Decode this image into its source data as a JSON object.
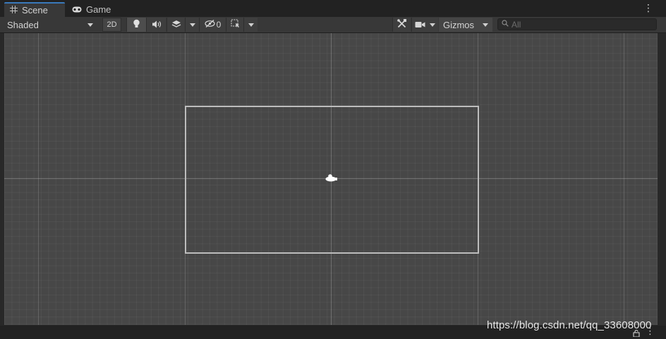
{
  "tabs": [
    {
      "label": "Scene",
      "icon": "grid-icon",
      "active": true
    },
    {
      "label": "Game",
      "icon": "gamepad-icon",
      "active": false
    }
  ],
  "toolbar": {
    "shading_mode": "Shaded",
    "mode_2d_label": "2D",
    "hidden_count": "0",
    "gizmos_label": "Gizmos",
    "search_placeholder": "All"
  },
  "watermark": "https://blog.csdn.net/qq_33608000",
  "colors": {
    "accent": "#3a79bb",
    "scene_background": "#474747",
    "toolbar_background": "#383838",
    "camera_frame": "#bdbdbd"
  }
}
